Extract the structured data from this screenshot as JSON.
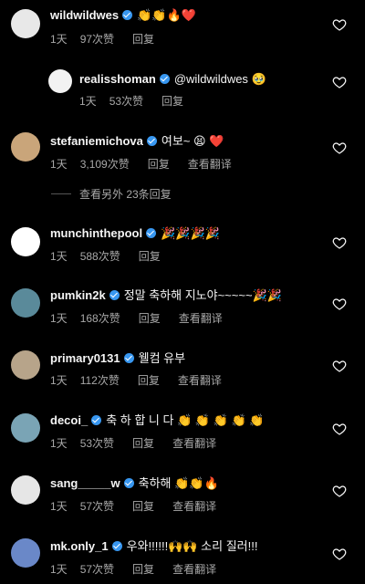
{
  "comments": [
    {
      "user": "wildwildwes",
      "verified": true,
      "text": "👏👏🔥❤️",
      "time": "1天",
      "likes": "97次赞",
      "reply": "回复",
      "translate": "",
      "is_reply": false,
      "avatar_color": "#e8e8e8"
    },
    {
      "user": "realisshoman",
      "verified": true,
      "text": "@wildwildwes 🥹",
      "time": "1天",
      "likes": "53次赞",
      "reply": "回复",
      "translate": "",
      "is_reply": true,
      "avatar_color": "#f2f2f2"
    },
    {
      "user": "stefaniemichova",
      "verified": true,
      "text": "여보~ 😫 ❤️",
      "time": "1天",
      "likes": "3,109次赞",
      "reply": "回复",
      "translate": "查看翻译",
      "is_reply": false,
      "avatar_color": "#c9a57a"
    },
    {
      "user": "munchinthepool",
      "verified": true,
      "text": "🎉🎉🎉🎉",
      "time": "1天",
      "likes": "588次赞",
      "reply": "回复",
      "translate": "",
      "is_reply": false,
      "avatar_color": "#ffffff"
    },
    {
      "user": "pumkin2k",
      "verified": true,
      "text": "정말 축하해 지노야~~~~~🎉🎉",
      "time": "1天",
      "likes": "168次赞",
      "reply": "回复",
      "translate": "查看翻译",
      "is_reply": false,
      "avatar_color": "#5a8a9a"
    },
    {
      "user": "primary0131",
      "verified": true,
      "text": "웰컴 유부",
      "time": "1天",
      "likes": "112次赞",
      "reply": "回复",
      "translate": "查看翻译",
      "is_reply": false,
      "avatar_color": "#b7a48a"
    },
    {
      "user": "decoi_",
      "verified": true,
      "text": "축 하 합 니 다 👏 👏 👏 👏 👏",
      "time": "1天",
      "likes": "53次赞",
      "reply": "回复",
      "translate": "查看翻译",
      "is_reply": false,
      "avatar_color": "#7aa4b5"
    },
    {
      "user": "sang_____w",
      "verified": true,
      "text": "축하해 👏👏🔥",
      "time": "1天",
      "likes": "57次赞",
      "reply": "回复",
      "translate": "查看翻译",
      "is_reply": false,
      "avatar_color": "#e6e6e6"
    },
    {
      "user": "mk.only_1",
      "verified": true,
      "text": "우와!!!!!!🙌🙌 소리 질러!!!",
      "time": "1天",
      "likes": "57次赞",
      "reply": "回复",
      "translate": "查看翻译",
      "is_reply": false,
      "avatar_color": "#6a88c8"
    }
  ],
  "view_more_replies": "查看另外 23条回复",
  "icons": {
    "like": "heart-outline-icon",
    "verified": "verified-badge-icon"
  },
  "colors": {
    "background": "#000000",
    "text": "#f5f5f5",
    "muted": "#a8a8a8",
    "verified": "#3897f0"
  }
}
